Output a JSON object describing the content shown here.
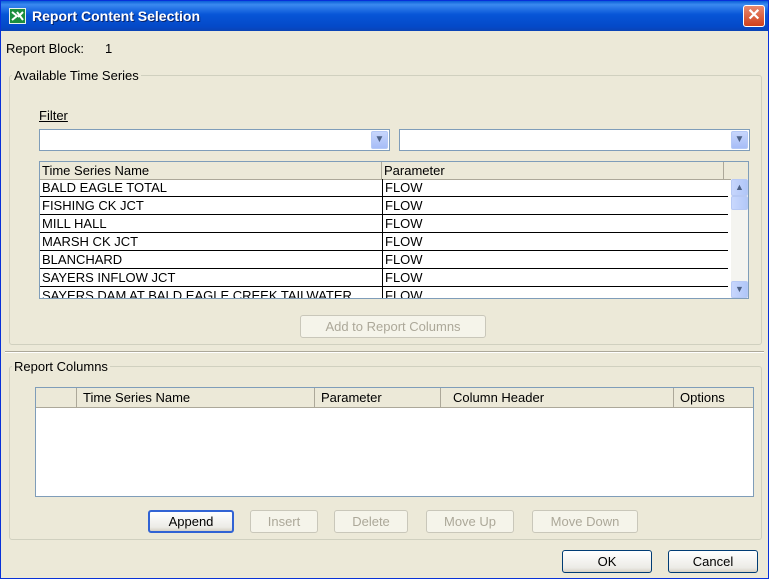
{
  "window": {
    "title": "Report Content Selection"
  },
  "report_block": {
    "label": "Report Block:",
    "value": "1"
  },
  "available": {
    "legend": "Available Time Series",
    "filter_label": "Filter",
    "filter1_value": "",
    "filter2_value": "",
    "columns": [
      "Time Series Name",
      "Parameter"
    ],
    "rows": [
      [
        "BALD EAGLE TOTAL",
        "FLOW"
      ],
      [
        "FISHING CK JCT",
        "FLOW"
      ],
      [
        "MILL HALL",
        "FLOW"
      ],
      [
        "MARSH CK JCT",
        "FLOW"
      ],
      [
        "BLANCHARD",
        "FLOW"
      ],
      [
        "SAYERS INFLOW JCT",
        "FLOW"
      ],
      [
        "SAYERS DAM AT BALD EAGLE CREEK TAILWATER",
        "FLOW"
      ]
    ],
    "add_button": "Add to Report Columns"
  },
  "report_columns": {
    "legend": "Report Columns",
    "columns": [
      "",
      "Time Series Name",
      "Parameter",
      "Column Header",
      "Options"
    ],
    "buttons": {
      "append": "Append",
      "insert": "Insert",
      "delete": "Delete",
      "move_up": "Move Up",
      "move_down": "Move Down"
    }
  },
  "dialog_buttons": {
    "ok": "OK",
    "cancel": "Cancel"
  },
  "colors": {
    "titlebar": "#0449c8",
    "dialog_bg": "#ece9d8",
    "selection_border": "#3163d4"
  }
}
